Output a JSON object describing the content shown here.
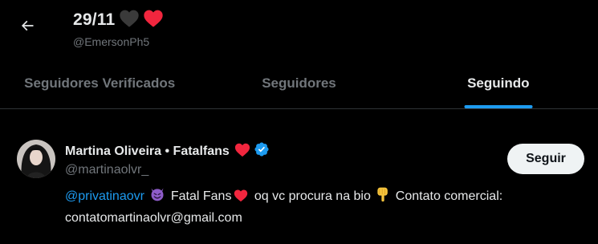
{
  "header": {
    "back_icon": "arrow-left-icon",
    "title": "29/11",
    "title_emojis": [
      "black-heart-icon",
      "red-heart-icon"
    ],
    "handle": "@EmersonPh5"
  },
  "tabs": [
    {
      "label": "Seguidores Verificados",
      "active": false
    },
    {
      "label": "Seguidores",
      "active": false
    },
    {
      "label": "Seguindo",
      "active": true
    }
  ],
  "user": {
    "name": "Martina Oliveira • Fatalfans",
    "name_icons": [
      "red-heart-icon",
      "verified-badge-icon"
    ],
    "handle": "@martinaolvr_",
    "follow_label": "Seguir",
    "bio": {
      "mention": "@privatinaovr",
      "text_a": "Fatal Fans",
      "text_b": "oq vc procura na bio",
      "text_c": "Contato comercial:",
      "email": "contatomartinaolvr@gmail.com"
    }
  },
  "colors": {
    "background": "#000000",
    "accent": "#1d9bf0",
    "text_primary": "#e7e9ea",
    "text_secondary": "#71767b",
    "heart_red": "#f91880"
  }
}
